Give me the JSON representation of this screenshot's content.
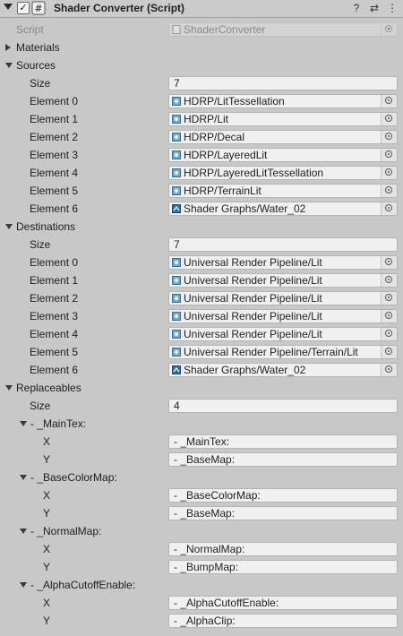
{
  "header": {
    "title": "Shader Converter (Script)",
    "enabled_check": "✓",
    "help_icon": "?",
    "presets_icon": "⇄",
    "menu_icon": "⋮"
  },
  "script": {
    "label": "Script",
    "value": "ShaderConverter"
  },
  "materials": {
    "label": "Materials"
  },
  "sources": {
    "label": "Sources",
    "size_label": "Size",
    "size": "7",
    "elements": [
      {
        "label": "Element 0",
        "value": "HDRP/LitTessellation",
        "kind": "shader"
      },
      {
        "label": "Element 1",
        "value": "HDRP/Lit",
        "kind": "shader"
      },
      {
        "label": "Element 2",
        "value": "HDRP/Decal",
        "kind": "shader"
      },
      {
        "label": "Element 3",
        "value": "HDRP/LayeredLit",
        "kind": "shader"
      },
      {
        "label": "Element 4",
        "value": "HDRP/LayeredLitTessellation",
        "kind": "shader"
      },
      {
        "label": "Element 5",
        "value": "HDRP/TerrainLit",
        "kind": "shader"
      },
      {
        "label": "Element 6",
        "value": "Shader Graphs/Water_02",
        "kind": "graph"
      }
    ]
  },
  "destinations": {
    "label": "Destinations",
    "size_label": "Size",
    "size": "7",
    "elements": [
      {
        "label": "Element 0",
        "value": "Universal Render Pipeline/Lit",
        "kind": "shader"
      },
      {
        "label": "Element 1",
        "value": "Universal Render Pipeline/Lit",
        "kind": "shader"
      },
      {
        "label": "Element 2",
        "value": "Universal Render Pipeline/Lit",
        "kind": "shader"
      },
      {
        "label": "Element 3",
        "value": "Universal Render Pipeline/Lit",
        "kind": "shader"
      },
      {
        "label": "Element 4",
        "value": "Universal Render Pipeline/Lit",
        "kind": "shader"
      },
      {
        "label": "Element 5",
        "value": "Universal Render Pipeline/Terrain/Lit",
        "kind": "shader"
      },
      {
        "label": "Element 6",
        "value": "Shader Graphs/Water_02",
        "kind": "graph"
      }
    ]
  },
  "replaceables": {
    "label": "Replaceables",
    "size_label": "Size",
    "size": "4",
    "items": [
      {
        "label": "- _MainTex:",
        "x_label": "X",
        "x": "- _MainTex:",
        "y_label": "Y",
        "y": "- _BaseMap:"
      },
      {
        "label": "- _BaseColorMap:",
        "x_label": "X",
        "x": "- _BaseColorMap:",
        "y_label": "Y",
        "y": "- _BaseMap:"
      },
      {
        "label": "- _NormalMap:",
        "x_label": "X",
        "x": "- _NormalMap:",
        "y_label": "Y",
        "y": "- _BumpMap:"
      },
      {
        "label": "- _AlphaCutoffEnable:",
        "x_label": "X",
        "x": "- _AlphaCutoffEnable:",
        "y_label": "Y",
        "y": "- _AlphaClip:"
      }
    ]
  },
  "colors": {
    "background": "#c8c8c8",
    "field": "#f0f0f0",
    "shader_icon": "#6aa8d8",
    "graph_icon": "#2f6fa8"
  }
}
